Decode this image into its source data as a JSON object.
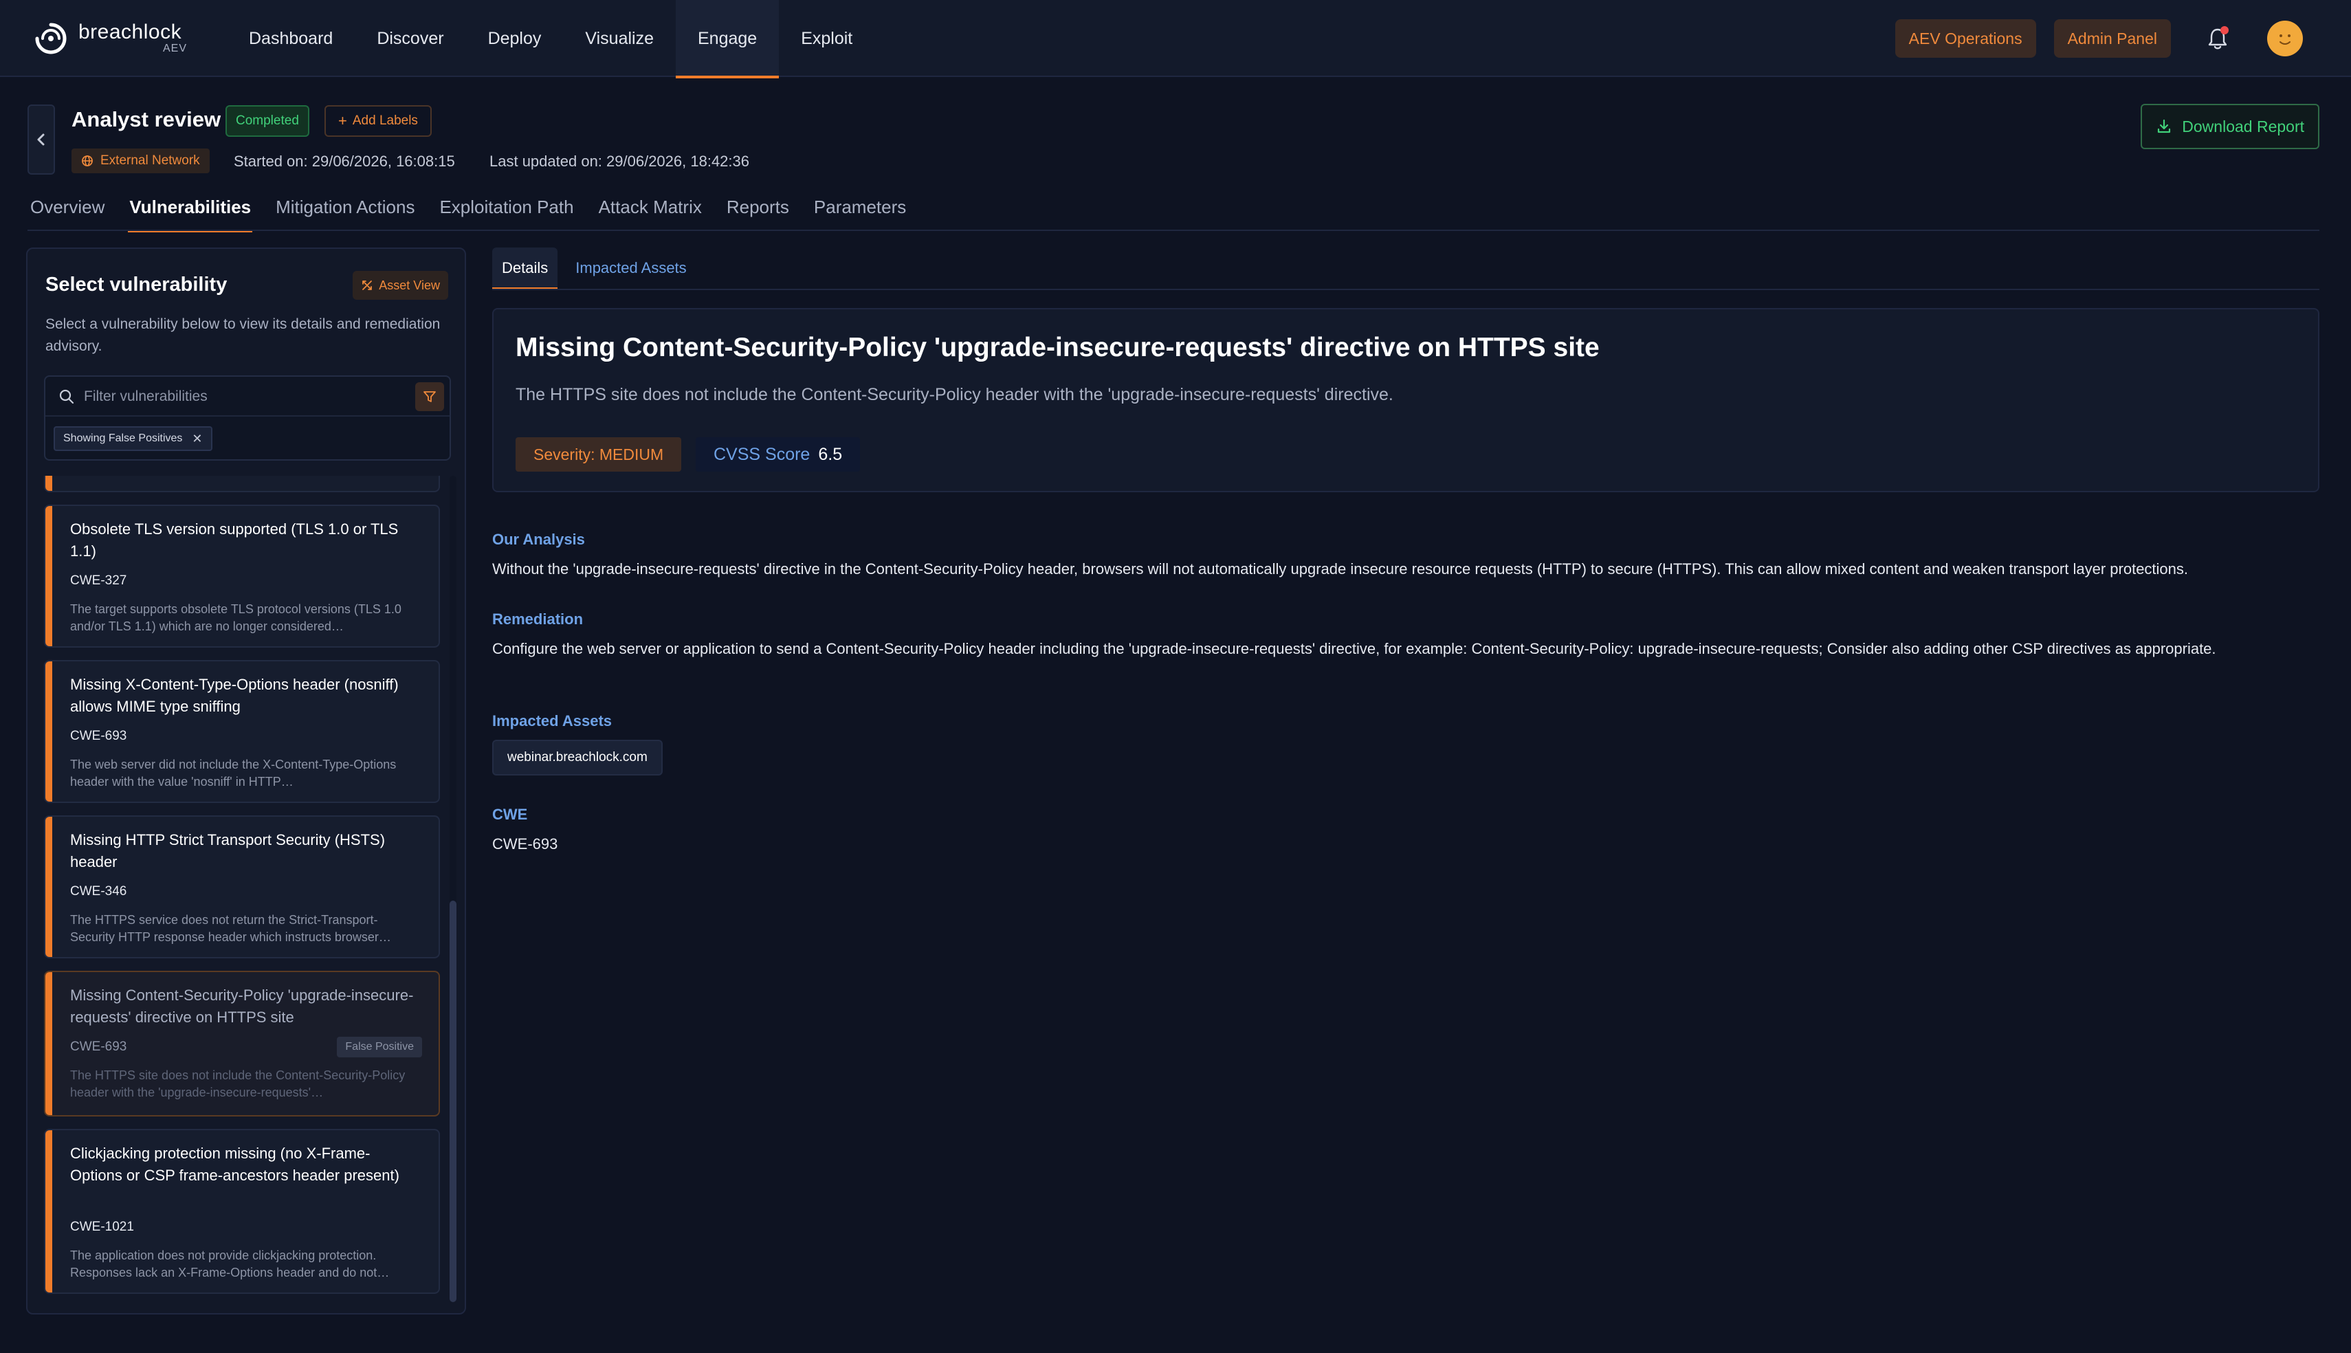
{
  "brand": {
    "name": "breachlock",
    "sub": "AEV"
  },
  "nav": {
    "items": [
      {
        "label": "Dashboard",
        "active": false
      },
      {
        "label": "Discover",
        "active": false
      },
      {
        "label": "Deploy",
        "active": false
      },
      {
        "label": "Visualize",
        "active": false
      },
      {
        "label": "Engage",
        "active": true
      },
      {
        "label": "Exploit",
        "active": false
      }
    ],
    "aev_operations": "AEV Operations",
    "admin_panel": "Admin Panel"
  },
  "header": {
    "title": "Analyst review",
    "status": "Completed",
    "add_labels": "Add Labels",
    "network": "External Network",
    "started": "Started on: 29/06/2026, 16:08:15",
    "updated": "Last updated on: 29/06/2026, 18:42:36",
    "download": "Download Report"
  },
  "tabs": [
    {
      "label": "Overview",
      "active": false
    },
    {
      "label": "Vulnerabilities",
      "active": true
    },
    {
      "label": "Mitigation Actions",
      "active": false
    },
    {
      "label": "Exploitation Path",
      "active": false
    },
    {
      "label": "Attack Matrix",
      "active": false
    },
    {
      "label": "Reports",
      "active": false
    },
    {
      "label": "Parameters",
      "active": false
    }
  ],
  "sidebar": {
    "title": "Select vulnerability",
    "asset_view": "Asset View",
    "description": "Select a vulnerability below to view its details and remediation advisory.",
    "filter_placeholder": "Filter vulnerabilities",
    "chip": "Showing False Positives",
    "items": [
      {
        "title": "Obsolete TLS version supported (TLS 1.0 or TLS 1.1)",
        "cwe": "CWE-327",
        "desc": "The target supports obsolete TLS protocol versions (TLS 1.0 and/or TLS 1.1) which are no longer considered…",
        "selected": false
      },
      {
        "title": "Missing X-Content-Type-Options header (nosniff) allows MIME type sniffing",
        "cwe": "CWE-693",
        "desc": "The web server did not include the X-Content-Type-Options header with the value 'nosniff' in HTTP…",
        "selected": false
      },
      {
        "title": "Missing HTTP Strict Transport Security (HSTS) header",
        "cwe": "CWE-346",
        "desc": "The HTTPS service does not return the Strict-Transport-Security HTTP response header which instructs browser…",
        "selected": false
      },
      {
        "title": "Missing Content-Security-Policy 'upgrade-insecure-requests' directive on HTTPS site",
        "cwe": "CWE-693",
        "badge": "False Positive",
        "desc": "The HTTPS site does not include the Content-Security-Policy header with the 'upgrade-insecure-requests'…",
        "selected": true
      },
      {
        "title": "Clickjacking protection missing (no X-Frame-Options or CSP frame-ancestors header present)",
        "cwe": "CWE-1021",
        "desc": "The application does not provide clickjacking protection. Responses lack an X-Frame-Options header and do not…",
        "selected": false
      }
    ]
  },
  "subtabs": [
    {
      "label": "Details",
      "active": true
    },
    {
      "label": "Impacted Assets",
      "active": false
    }
  ],
  "detail": {
    "title": "Missing Content-Security-Policy 'upgrade-insecure-requests' directive on HTTPS site",
    "description": "The HTTPS site does not include the Content-Security-Policy header with the 'upgrade-insecure-requests' directive.",
    "severity": "Severity: MEDIUM",
    "cvss_label": "CVSS Score",
    "cvss_value": "6.5",
    "analysis_label": "Our Analysis",
    "analysis": "Without the 'upgrade-insecure-requests' directive in the Content-Security-Policy header, browsers will not automatically upgrade insecure resource requests (HTTP) to secure (HTTPS). This can allow mixed content and weaken transport layer protections.",
    "remediation_label": "Remediation",
    "remediation": "Configure the web server or application to send a Content-Security-Policy header including the 'upgrade-insecure-requests' directive, for example: Content-Security-Policy: upgrade-insecure-requests; Consider also adding other CSP directives as appropriate.",
    "assets_label": "Impacted Assets",
    "asset": "webinar.breachlock.com",
    "cwe_label": "CWE",
    "cwe": "CWE-693"
  },
  "colors": {
    "accent": "#f07c2a",
    "success": "#41d17a",
    "link": "#6fa2e6",
    "bg": "#0e1322"
  }
}
